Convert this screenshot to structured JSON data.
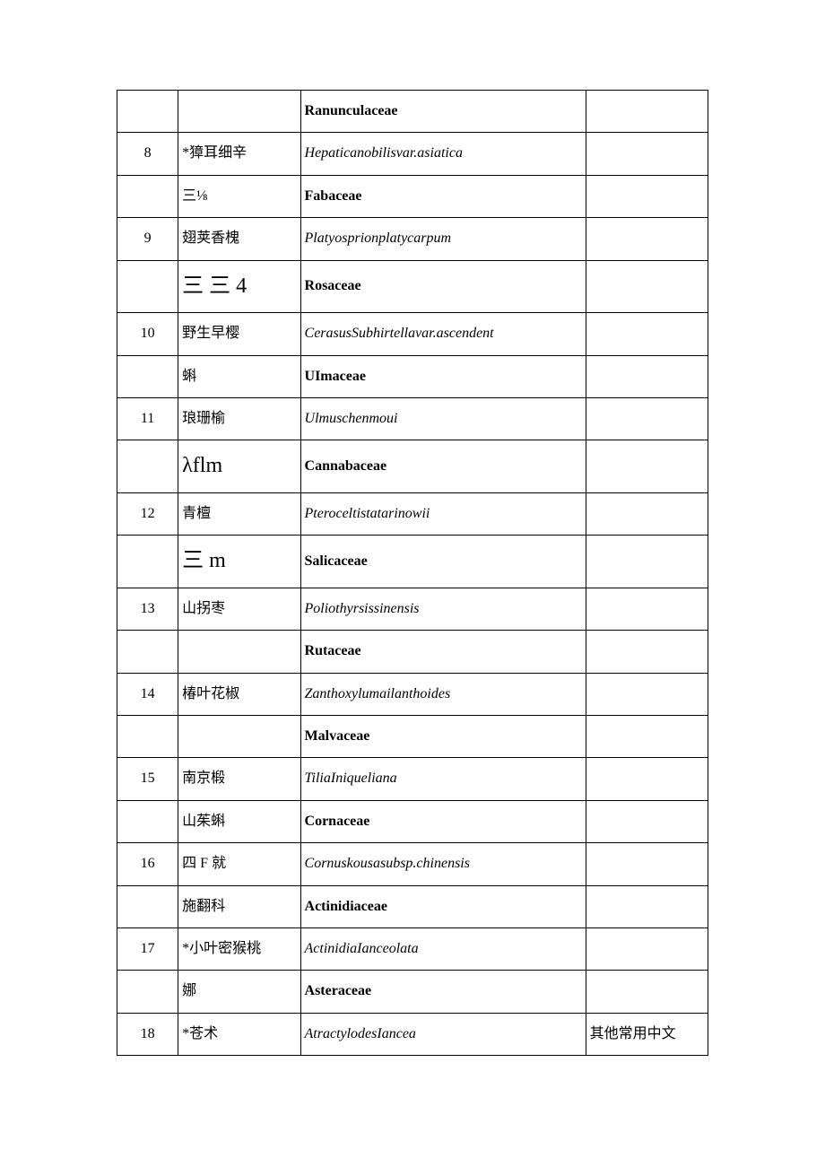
{
  "rows": [
    {
      "num": "",
      "cn": "",
      "cn_class": "",
      "lat": "Ranunculaceae",
      "lat_kind": "family",
      "note": ""
    },
    {
      "num": "8",
      "cn": "*獐耳细辛",
      "cn_class": "",
      "lat": "Hepaticanobilisvar.asiatica",
      "lat_kind": "species",
      "note": ""
    },
    {
      "num": "",
      "cn": "三⅛",
      "cn_class": "",
      "lat": "Fabaceae",
      "lat_kind": "family",
      "note": ""
    },
    {
      "num": "9",
      "cn": "翅荚香槐",
      "cn_class": "",
      "lat": "Platyosprionplatycarpum",
      "lat_kind": "species",
      "note": ""
    },
    {
      "num": "",
      "cn": "三 三 4",
      "cn_class": "cn-big",
      "lat": "Rosaceae",
      "lat_kind": "family",
      "note": ""
    },
    {
      "num": "10",
      "cn": "野生早樱",
      "cn_class": "",
      "lat": "CerasusSubhirtellavar.ascendent",
      "lat_kind": "species",
      "note": ""
    },
    {
      "num": "",
      "cn": "蝌",
      "cn_class": "",
      "lat": "UImaceae",
      "lat_kind": "family",
      "note": ""
    },
    {
      "num": "11",
      "cn": "琅珊榆",
      "cn_class": "",
      "lat": "Ulmuschenmoui",
      "lat_kind": "species",
      "note": ""
    },
    {
      "num": "",
      "cn": "λflm",
      "cn_class": "cn-big",
      "lat": "Cannabaceae",
      "lat_kind": "family",
      "note": ""
    },
    {
      "num": "12",
      "cn": "青檀",
      "cn_class": "",
      "lat": "Pteroceltistatarinowii",
      "lat_kind": "species",
      "note": ""
    },
    {
      "num": "",
      "cn": "三 m",
      "cn_class": "cn-big",
      "lat": "Salicaceae",
      "lat_kind": "family",
      "note": ""
    },
    {
      "num": "13",
      "cn": "山拐枣",
      "cn_class": "",
      "lat": "Poliothyrsissinensis",
      "lat_kind": "species",
      "note": ""
    },
    {
      "num": "",
      "cn": "",
      "cn_class": "",
      "lat": "Rutaceae",
      "lat_kind": "family",
      "note": ""
    },
    {
      "num": "14",
      "cn": "椿叶花椒",
      "cn_class": "",
      "lat": "Zanthoxylumailanthoides",
      "lat_kind": "species",
      "note": ""
    },
    {
      "num": "",
      "cn": "",
      "cn_class": "",
      "lat": "Malvaceae",
      "lat_kind": "family",
      "note": ""
    },
    {
      "num": "15",
      "cn": "南京椴",
      "cn_class": "",
      "lat": "TiliaIniqueliana",
      "lat_kind": "species",
      "note": ""
    },
    {
      "num": "",
      "cn": "山茱蝌",
      "cn_class": "",
      "lat": "Cornaceae",
      "lat_kind": "family",
      "note": ""
    },
    {
      "num": "16",
      "cn": "四 F 就",
      "cn_class": "",
      "lat": "Cornuskousasubsp.chinensis",
      "lat_kind": "species",
      "note": ""
    },
    {
      "num": "",
      "cn": "施翻科",
      "cn_class": "",
      "lat": "Actinidiaceae",
      "lat_kind": "family",
      "note": ""
    },
    {
      "num": "17",
      "cn": "*小叶密猴桃",
      "cn_class": "",
      "lat": "ActinidiaIanceolata",
      "lat_kind": "species",
      "note": ""
    },
    {
      "num": "",
      "cn": "娜",
      "cn_class": "",
      "lat": "Asteraceae",
      "lat_kind": "family",
      "note": ""
    },
    {
      "num": "18",
      "cn": "*苍术",
      "cn_class": "",
      "lat": "AtractylodesIancea",
      "lat_kind": "species",
      "note": "其他常用中文"
    }
  ]
}
